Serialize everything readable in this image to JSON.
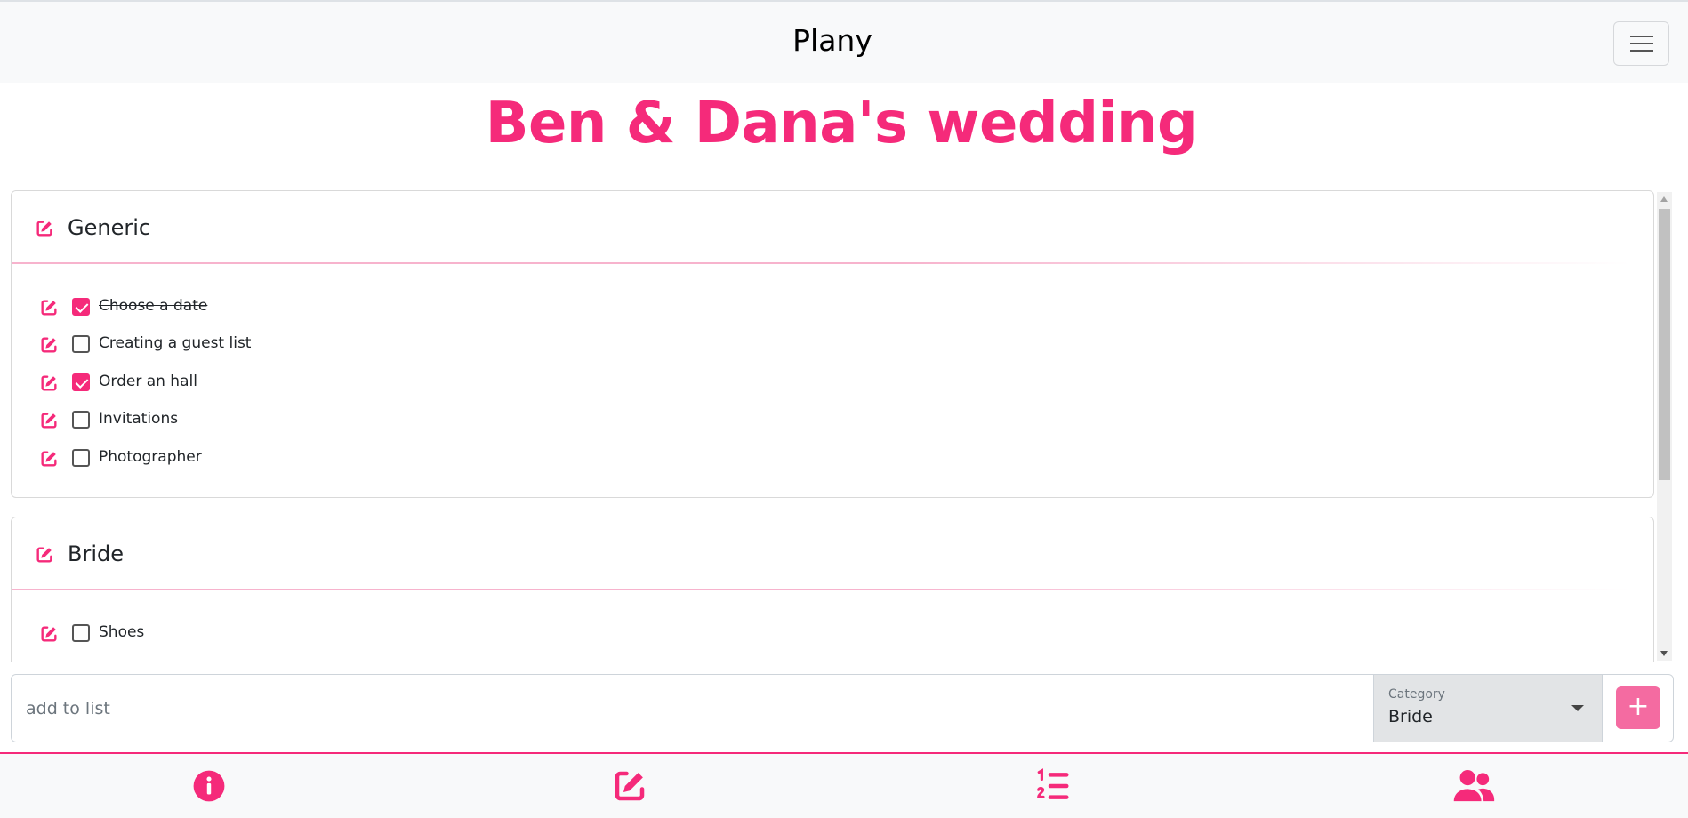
{
  "header": {
    "brand": "Plany",
    "menu_icon": "hamburger-icon"
  },
  "page": {
    "title": "Ben & Dana's wedding"
  },
  "colors": {
    "accent": "#f52a7a",
    "add_button": "#f46ba1"
  },
  "categories": [
    {
      "title": "Generic",
      "items": [
        {
          "label": "Choose a date",
          "checked": true
        },
        {
          "label": "Creating a guest list",
          "checked": false
        },
        {
          "label": "Order an hall",
          "checked": true
        },
        {
          "label": "Invitations",
          "checked": false
        },
        {
          "label": "Photographer",
          "checked": false
        }
      ]
    },
    {
      "title": "Bride",
      "items": [
        {
          "label": "Shoes",
          "checked": false
        }
      ]
    }
  ],
  "add_bar": {
    "placeholder": "add to list",
    "category_caption": "Category",
    "category_value": "Bride",
    "add_label": "+"
  },
  "bottom_nav": {
    "items": [
      {
        "icon": "info-circle-icon"
      },
      {
        "icon": "edit-icon"
      },
      {
        "icon": "numbered-list-icon"
      },
      {
        "icon": "users-icon"
      }
    ]
  }
}
